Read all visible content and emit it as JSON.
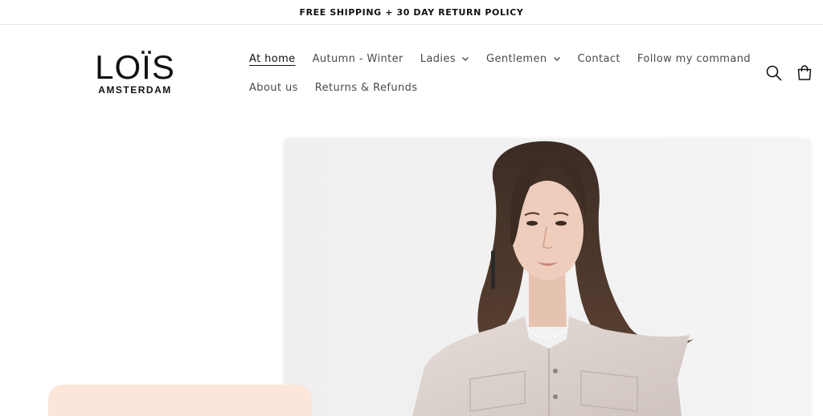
{
  "announcement": {
    "text": "FREE SHIPPING + 30 DAY RETURN POLICY"
  },
  "logo": {
    "main": "LOÏS",
    "sub": "AMSTERDAM"
  },
  "nav": {
    "row1": [
      {
        "label": "At home",
        "active": true,
        "dropdown": false
      },
      {
        "label": "Autumn - Winter",
        "dropdown": false
      },
      {
        "label": "Ladies",
        "dropdown": true
      },
      {
        "label": "Gentlemen",
        "dropdown": true
      },
      {
        "label": "Contact",
        "dropdown": false
      },
      {
        "label": "Follow my command",
        "dropdown": false
      }
    ],
    "row2": [
      {
        "label": "About us",
        "dropdown": false
      },
      {
        "label": "Returns & Refunds",
        "dropdown": false
      }
    ]
  },
  "icons": {
    "search": "search-icon",
    "cart": "cart-icon"
  },
  "colors": {
    "accent_card": "#fbe6d9",
    "text": "#121212",
    "nav_text": "#4a4a4a"
  },
  "hero": {
    "image": "woman-in-light-sleeveless-jacket"
  }
}
